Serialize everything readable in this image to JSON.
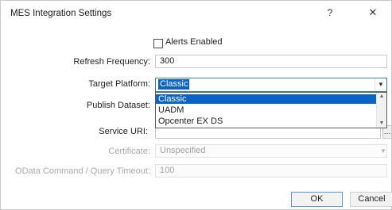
{
  "window": {
    "title": "MES Integration Settings",
    "help_glyph": "?",
    "close_glyph": "✕"
  },
  "alerts": {
    "label": "Alerts Enabled",
    "checked": false
  },
  "fields": {
    "refresh_frequency": {
      "label": "Refresh Frequency:",
      "value": "300"
    },
    "target_platform": {
      "label": "Target Platform:",
      "value": "Classic"
    },
    "publish_dataset": {
      "label": "Publish Dataset:"
    },
    "service_uri": {
      "label": "Service URI:"
    },
    "certificate": {
      "label": "Certificate:",
      "value": "Unspecified"
    },
    "odata_timeout": {
      "label": "OData Command / Query Timeout:",
      "value": "100"
    }
  },
  "dropdown": {
    "options": [
      "Classic",
      "UADM",
      "Opcenter EX DS"
    ],
    "selected_index": 0
  },
  "buttons": {
    "ok": "OK",
    "cancel": "Cancel"
  },
  "colors": {
    "selection": "#0a64c8",
    "focus_border": "#3c7fb1",
    "disabled_text": "#a9a9a9"
  },
  "icons": {
    "select_arrow": "chevron-down-icon",
    "close": "close-icon",
    "help": "help-icon"
  }
}
